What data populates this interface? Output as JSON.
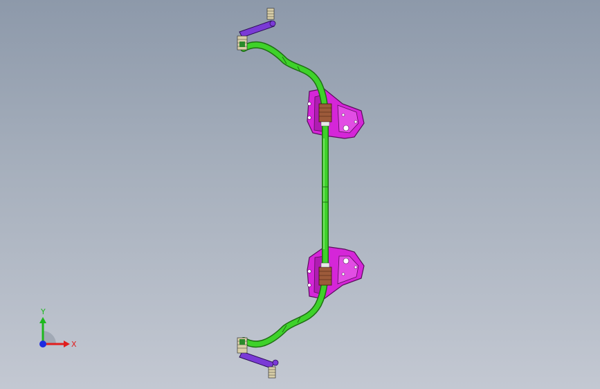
{
  "viewport": {
    "background_top": "#8d99aa",
    "background_bottom": "#c3c8d2"
  },
  "model": {
    "bar_color": "#3ed22a",
    "bar_outline": "#1f6e14",
    "bracket_color": "#d526d8",
    "bracket_outline": "#5a0c5c",
    "bushing_color": "#9c5a3a",
    "link_color": "#7a3ad6",
    "link_outline": "#2a0d55"
  },
  "triad": {
    "y_label": "Y",
    "x_label": "X",
    "y_color": "#1db81d",
    "x_color": "#e11d1d",
    "z_color": "#1d2ae1",
    "icons": [
      "y-axis-arrow-icon",
      "x-axis-arrow-icon",
      "z-axis-origin-icon"
    ]
  }
}
